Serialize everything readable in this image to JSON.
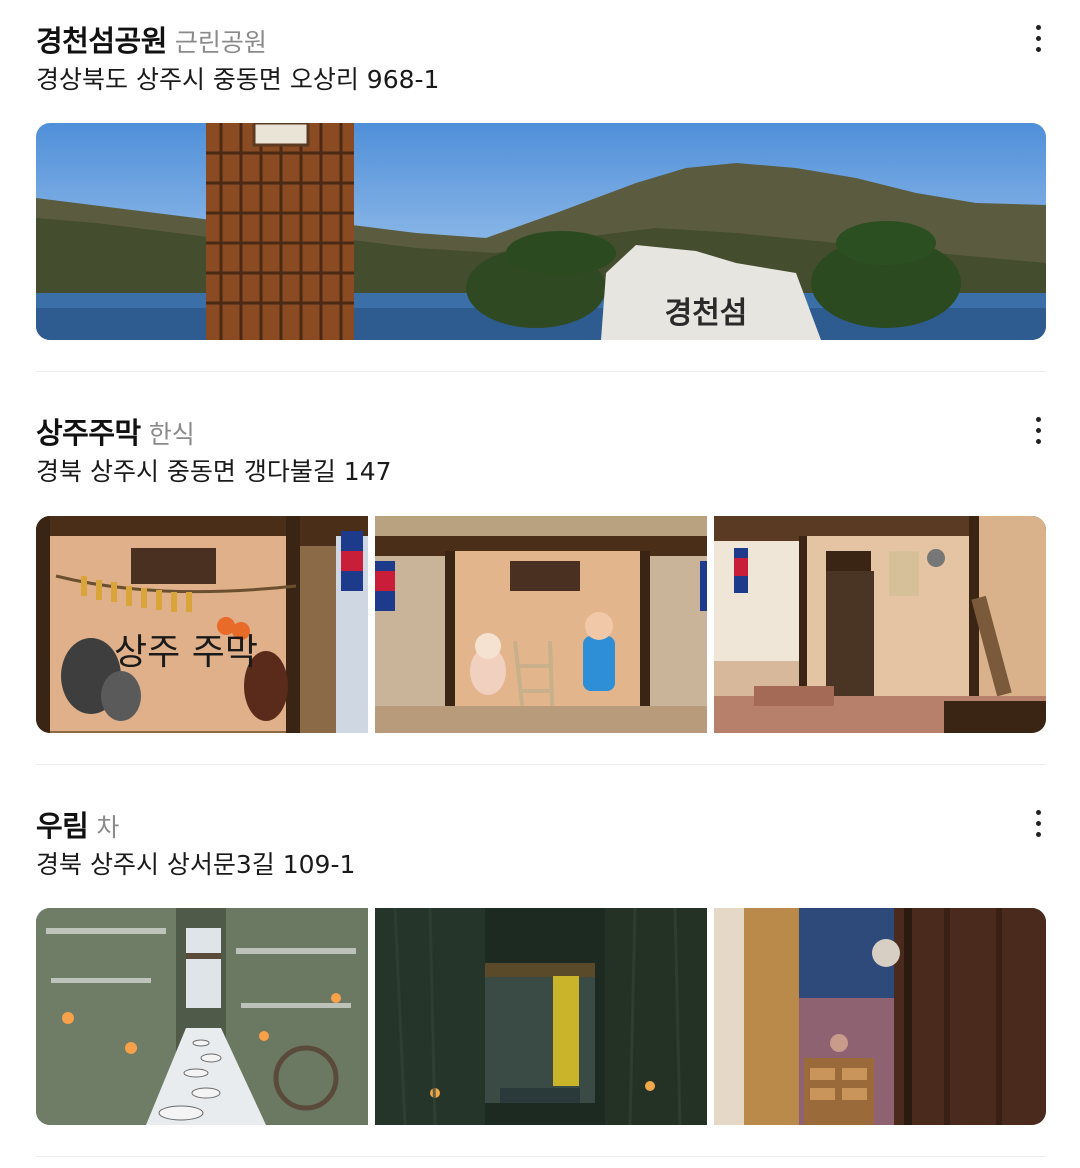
{
  "places": [
    {
      "name": "경천섬공원",
      "category": "근린공원",
      "address": "경상북도 상주시 중동면 오상리 968-1",
      "photos": [
        {
          "subject": "river park with clock tower and stone sign",
          "sign_text": "경천섬"
        }
      ]
    },
    {
      "name": "상주주막",
      "category": "한식",
      "address": "경북 상주시 중동면 갱다불길 147",
      "photos": [
        {
          "subject": "thatched tavern wall mural",
          "sign_text": "상주 주막"
        },
        {
          "subject": "mural with cartoon figures and ladder"
        },
        {
          "subject": "traditional house with wooden door"
        }
      ]
    },
    {
      "name": "우림",
      "category": "차",
      "address": "경북 상주시 상서문3길 109-1",
      "photos": [
        {
          "subject": "snowy bamboo garden path with lanterns"
        },
        {
          "subject": "dark bamboo entrance at night"
        },
        {
          "subject": "wooden interior with cat"
        }
      ]
    }
  ],
  "icons": {
    "more": "more-vertical-icon"
  },
  "colors": {
    "category": "#8a8a8a",
    "divider": "#ececec"
  }
}
